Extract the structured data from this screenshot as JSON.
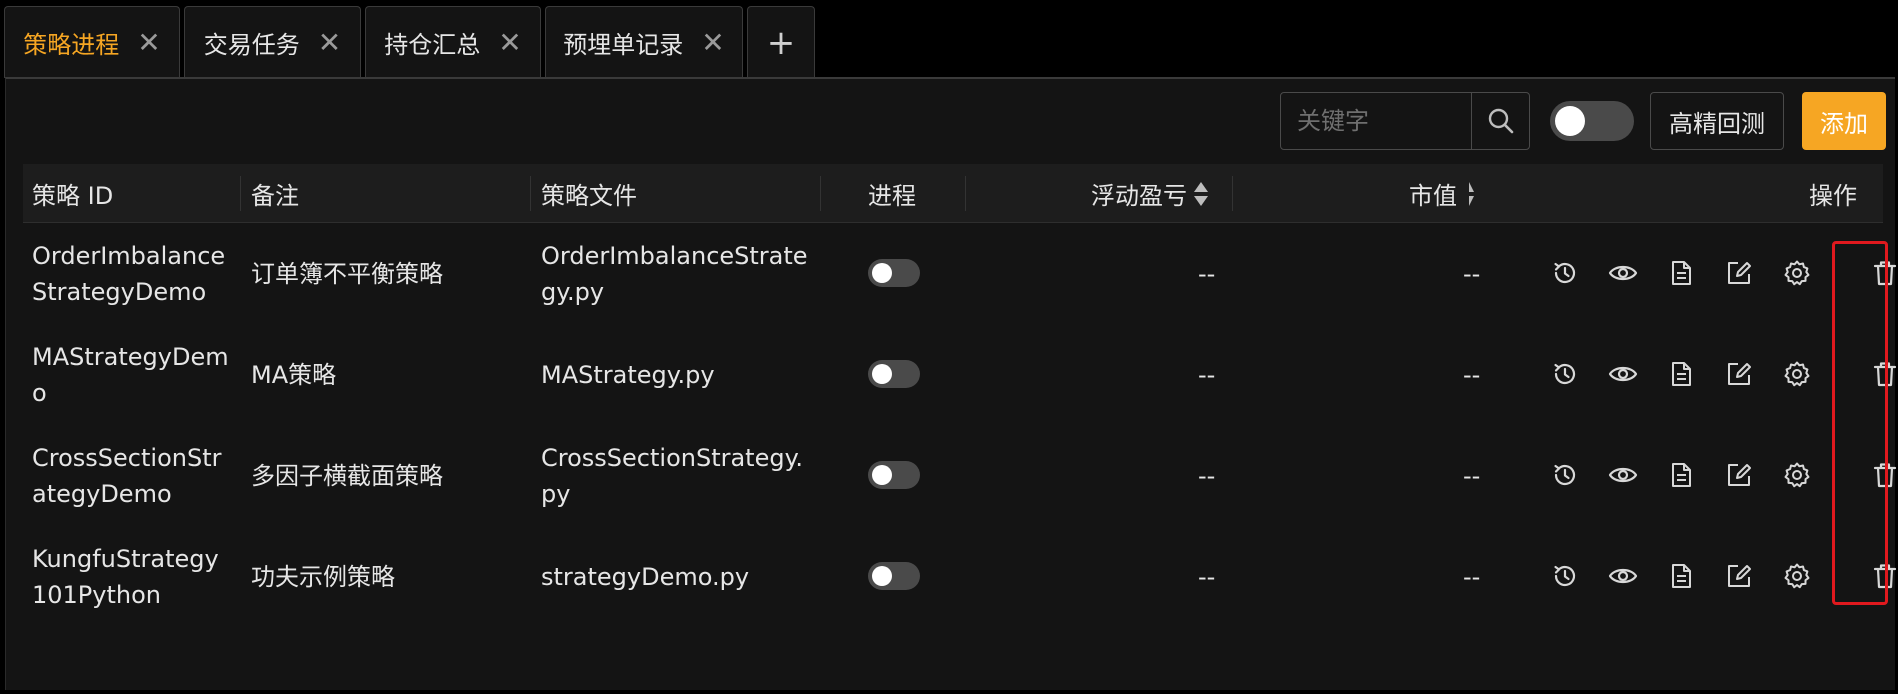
{
  "tabs": [
    {
      "label": "策略进程",
      "active": true
    },
    {
      "label": "交易任务",
      "active": false
    },
    {
      "label": "持仓汇总",
      "active": false
    },
    {
      "label": "预埋单记录",
      "active": false
    }
  ],
  "add_tab_label": "+",
  "toolbar": {
    "search_placeholder": "关键字",
    "high_precision_label": "高精回测",
    "add_label": "添加"
  },
  "table": {
    "headers": {
      "id": "策略 ID",
      "note": "备注",
      "file": "策略文件",
      "process": "进程",
      "pnl": "浮动盈亏",
      "market_value": "市值",
      "actions": "操作"
    },
    "rows": [
      {
        "id": "OrderImbalanceStrategyDemo",
        "note": "订单簿不平衡策略",
        "file": "OrderImbalanceStrategy.py",
        "pnl": "--",
        "market_value": "--"
      },
      {
        "id": "MAStrategyDemo",
        "note": "MA策略",
        "file": "MAStrategy.py",
        "pnl": "--",
        "market_value": "--"
      },
      {
        "id": "CrossSectionStrategyDemo",
        "note": "多因子横截面策略",
        "file": "CrossSectionStrategy.py",
        "pnl": "--",
        "market_value": "--"
      },
      {
        "id": "KungfuStrategy101Python",
        "note": "功夫示例策略",
        "file": "strategyDemo.py",
        "pnl": "--",
        "market_value": "--"
      }
    ]
  },
  "colors": {
    "accent": "#f6a623",
    "highlight": "#e0191e"
  },
  "action_icons": [
    "history-icon",
    "eye-icon",
    "document-icon",
    "edit-icon",
    "gear-icon",
    "trash-icon"
  ]
}
